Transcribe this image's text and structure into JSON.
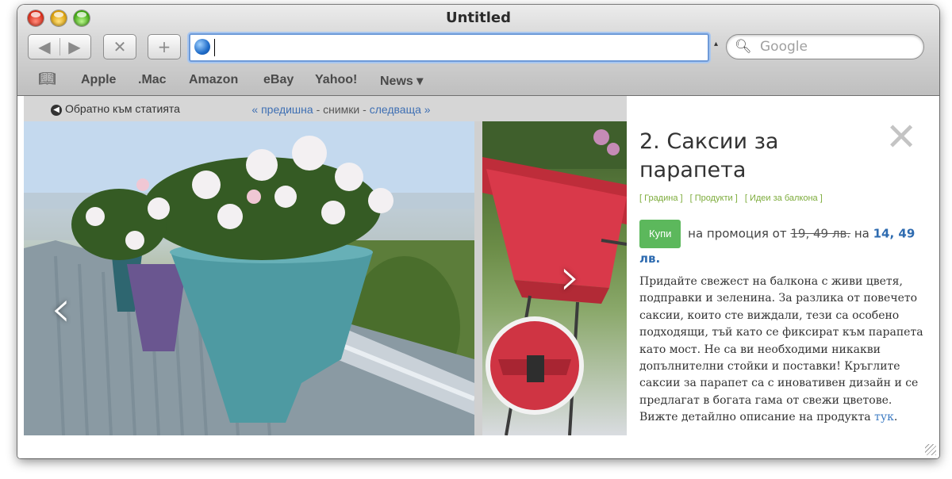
{
  "window": {
    "title": "Untitled"
  },
  "toolbar": {
    "back_glyph": "◀",
    "forward_glyph": "▶",
    "stop_glyph": "✕",
    "add_glyph": "+",
    "url_value": "",
    "search_placeholder": "Google"
  },
  "bookmarks": [
    "Apple",
    ".Mac",
    "Amazon",
    "eBay",
    "Yahoo!",
    "News ▾"
  ],
  "gallery": {
    "back_label": "Обратно към статията",
    "prev_label": "« предишна",
    "separator": "- снимки -",
    "next_label": "следваща »",
    "prev_arrow": "‹",
    "next_arrow": "›"
  },
  "product": {
    "title": "2. Саксии за парапета",
    "tags": [
      "[ Градина ]",
      "[ Продукти ]",
      "[ Идеи за балкона ]"
    ],
    "buy_label": "Купи",
    "promo_text": "на промоция от",
    "old_price": "19, 49 лв.",
    "price_joiner": "на",
    "new_price": "14, 49 лв.",
    "description": "Придайте свежест на балкона с живи цветя, подправки и зеленина. За разлика от повечето саксии, които сте виждали, тези са особено подходящи, тъй като се фиксират към парапета като мост. Не са ви необходими никакви допълнителни стойки и поставки! Кръглите саксии за парапет са с иновативен дизайн и се предлагат в богата гама от свежи цветове. Вижте детайлно описание на продукта",
    "link_label": "тук",
    "end_punct": "."
  }
}
